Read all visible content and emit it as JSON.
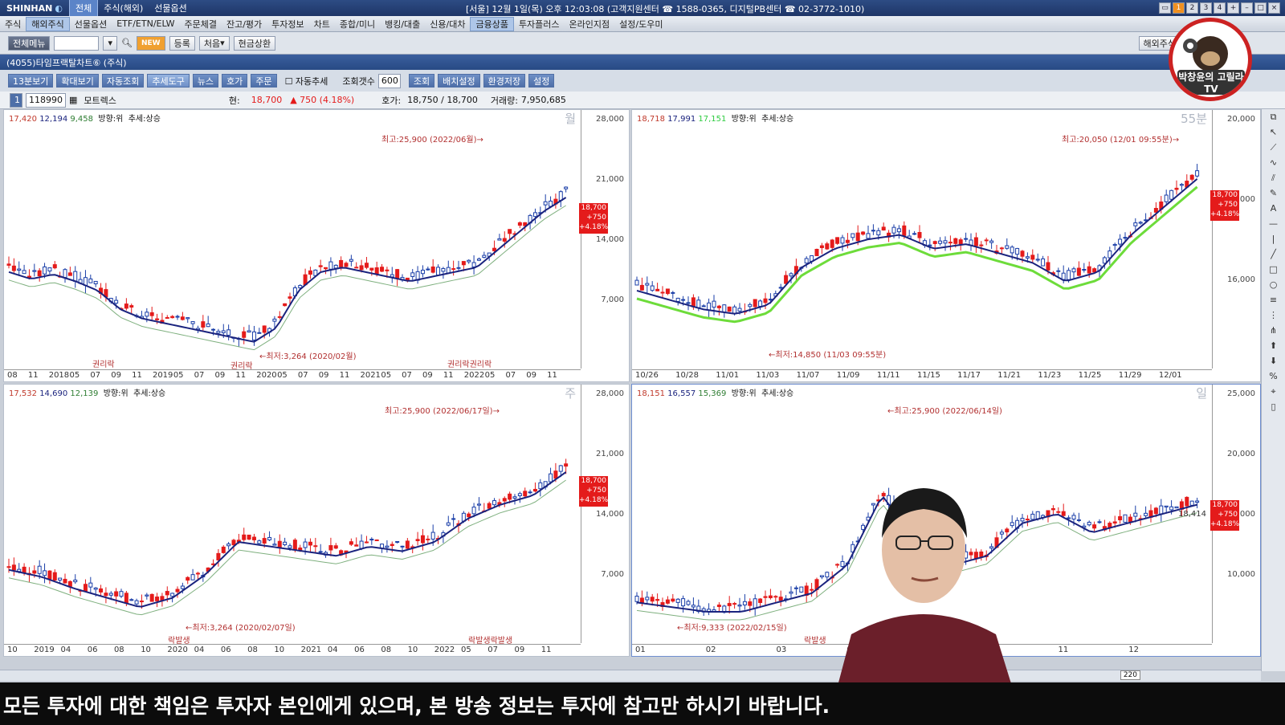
{
  "topbar": {
    "brand": "SHINHAN",
    "tabs": [
      "전체",
      "주식(해외)",
      "선물옵션"
    ],
    "info": "[서울] 12월 1일(목) 오후 12:03:08 (고객지원센터 ☎ 1588-0365, 디지털PB센터 ☎ 02-3772-1010)",
    "page_buttons": [
      "1",
      "2",
      "3",
      "4"
    ]
  },
  "menu": {
    "items": [
      "주식",
      "해외주식",
      "선물옵션",
      "ETF/ETN/ELW",
      "주문체결",
      "잔고/평가",
      "투자정보",
      "차트",
      "종합/미니",
      "뱅킹/대출",
      "신용/대차",
      "금융상품",
      "투자플러스",
      "온라인지점",
      "설정/도우미"
    ],
    "active_index": [
      1,
      11
    ]
  },
  "toolbar": {
    "all_menu": "전체메뉴",
    "new": "NEW",
    "register": "등록",
    "select": "처음",
    "cash": "현금상환",
    "right1": "해외주식"
  },
  "window": {
    "title": "(4055)타임프랙탈차트⑥ (주식)"
  },
  "subtool": {
    "buttons": [
      "13분보기",
      "확대보기",
      "자동조회",
      "추세도구",
      "뉴스",
      "호가",
      "주문"
    ],
    "auto_trend": "자동추세",
    "count_label": "조회갯수",
    "count_value": "600",
    "query": "조회",
    "layout": "배치설정",
    "save": "환경저장",
    "settings": "설정"
  },
  "infobar": {
    "num": "1",
    "code": "118990",
    "name": "모트렉스",
    "price_label": "현:",
    "price": "18,700",
    "change": "▲ 750 (4.18%)",
    "bidask_label": "호가:",
    "bidask": "18,750 / 18,700",
    "volume_label": "거래량:",
    "volume": "7,950,685"
  },
  "panes": [
    {
      "ma": [
        "17,420",
        "12,194",
        "9,458"
      ],
      "dir": "방향:위",
      "trend": "추세:상승",
      "period": "월",
      "yticks": [
        "28,000",
        "21,000",
        "14,000",
        "7,000"
      ],
      "high": "최고:25,900 (2022/06월)→",
      "low": "←최저:3,264 (2020/02월)",
      "events": [
        "권리락",
        "권리락",
        "권리락권리락"
      ],
      "xticks": [
        "08",
        "11",
        "2018",
        "05",
        "07",
        "09",
        "11",
        "2019",
        "05",
        "07",
        "09",
        "11",
        "2020",
        "05",
        "07",
        "09",
        "11",
        "2021",
        "05",
        "07",
        "09",
        "11",
        "2022",
        "05",
        "07",
        "09",
        "11"
      ],
      "pricebox": [
        "18,700",
        "+750",
        "+4.18%"
      ]
    },
    {
      "ma": [
        "18,718",
        "17,991",
        "17,151"
      ],
      "dir": "방향:위",
      "trend": "추세:상승",
      "period": "55분",
      "yticks": [
        "20,000",
        "18,000",
        "16,000"
      ],
      "high": "최고:20,050 (12/01 09:55분)→",
      "low": "←최저:14,850 (11/03 09:55분)",
      "xticks": [
        "10/26",
        "10/28",
        "11/01",
        "11/03",
        "11/07",
        "11/09",
        "11/11",
        "11/15",
        "11/17",
        "11/21",
        "11/23",
        "11/25",
        "11/29",
        "12/01"
      ],
      "pricebox": [
        "18,700",
        "+750",
        "+4.18%"
      ]
    },
    {
      "ma": [
        "17,532",
        "14,690",
        "12,139"
      ],
      "dir": "방향:위",
      "trend": "추세:상승",
      "period": "주",
      "yticks": [
        "28,000",
        "21,000",
        "14,000",
        "7,000"
      ],
      "high": "최고:25,900 (2022/06/17일)→",
      "low": "←최저:3,264 (2020/02/07일)",
      "events": [
        "락발생",
        "락발생락발생"
      ],
      "xticks": [
        "10",
        "2019",
        "04",
        "06",
        "08",
        "10",
        "2020",
        "04",
        "06",
        "08",
        "10",
        "2021",
        "04",
        "06",
        "08",
        "10",
        "2022",
        "05",
        "07",
        "09",
        "11"
      ],
      "pricebox": [
        "18,700",
        "+750",
        "+4.18%"
      ]
    },
    {
      "ma": [
        "18,151",
        "16,557",
        "15,369"
      ],
      "dir": "방향:위",
      "trend": "추세:상승",
      "period": "일",
      "yticks": [
        "25,000",
        "20,000",
        "15,000",
        "10,000"
      ],
      "high": "←최고:25,900 (2022/06/14일)",
      "low": "←최저:9,333 (2022/02/15일)",
      "events": [
        "락발생"
      ],
      "crosshair": "18,414",
      "xticks": [
        "01",
        "02",
        "03",
        "04",
        "05",
        "10",
        "11",
        "12"
      ],
      "pricebox": [
        "18,700",
        "+750",
        "+4.18%"
      ]
    }
  ],
  "status": {
    "zoom": "220"
  },
  "caption": "모든 투자에 대한 책임은 투자자 본인에게 있으며, 본 방송 정보는 투자에 참고만 하시기 바랍니다.",
  "logo": {
    "text": "박창윤의 고릴라TV"
  },
  "colors": {
    "up": "#e41b1b",
    "down": "#1a3ea8",
    "ma20": "#1a237e",
    "ma60": "#6ddc3a",
    "frame": "#284a84"
  }
}
